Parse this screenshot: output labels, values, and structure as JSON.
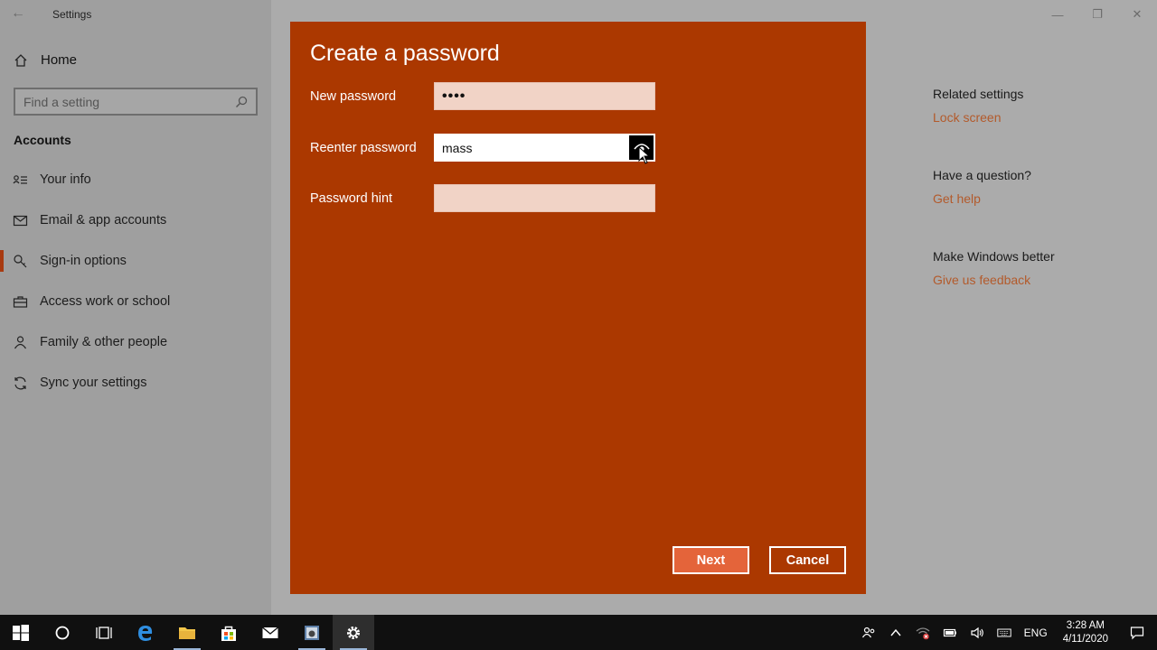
{
  "window": {
    "title": "Settings",
    "controls": {
      "minimize": "—",
      "restore": "❐",
      "close": "✕"
    }
  },
  "sidebar": {
    "home_label": "Home",
    "search_placeholder": "Find a setting",
    "section_title": "Accounts",
    "items": [
      {
        "label": "Your info",
        "icon": "person-card-icon"
      },
      {
        "label": "Email & app accounts",
        "icon": "mail-icon"
      },
      {
        "label": "Sign-in options",
        "icon": "key-icon",
        "active": true
      },
      {
        "label": "Access work or school",
        "icon": "briefcase-icon"
      },
      {
        "label": "Family & other people",
        "icon": "person-icon"
      },
      {
        "label": "Sync your settings",
        "icon": "sync-icon"
      }
    ]
  },
  "right": {
    "related_header": "Related settings",
    "related_link": "Lock screen",
    "question_header": "Have a question?",
    "question_link": "Get help",
    "better_header": "Make Windows better",
    "better_link": "Give us feedback"
  },
  "dialog": {
    "title": "Create a password",
    "new_password_label": "New password",
    "new_password_value": "••••",
    "reenter_label": "Reenter password",
    "reenter_value": "mass",
    "hint_label": "Password hint",
    "hint_value": "",
    "next_label": "Next",
    "cancel_label": "Cancel"
  },
  "taskbar": {
    "language": "ENG",
    "time": "3:28 AM",
    "date": "4/11/2020"
  },
  "colors": {
    "dialog_bg": "#ab3800",
    "next_button": "#e4643a",
    "link": "#b35a2b"
  }
}
